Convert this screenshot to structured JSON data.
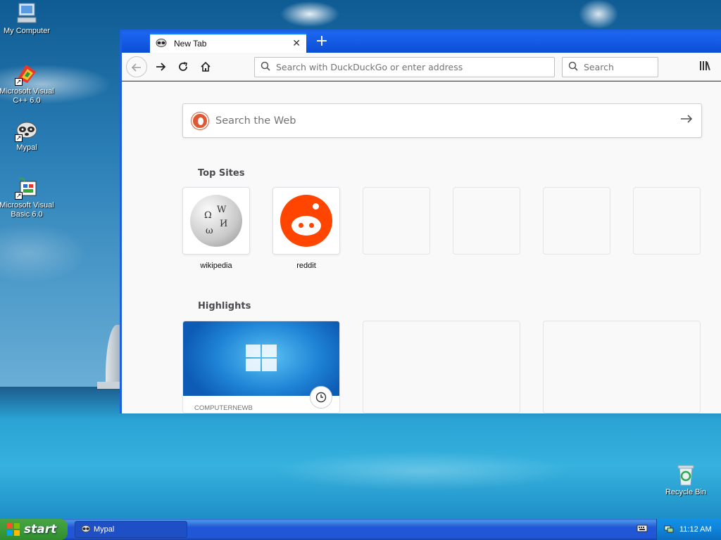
{
  "desktop": {
    "icons": [
      {
        "label": "My Computer"
      },
      {
        "label": "Microsoft Visual C++ 6.0"
      },
      {
        "label": "Mypal"
      },
      {
        "label": "Microsoft Visual Basic 6.0"
      },
      {
        "label": "Recycle Bin"
      }
    ]
  },
  "browser": {
    "tab": {
      "title": "New Tab",
      "close": "✕"
    },
    "new_tab": "+",
    "urlbar": {
      "placeholder": "Search with DuckDuckGo or enter address"
    },
    "searchbar": {
      "placeholder": "Search"
    },
    "websearch": {
      "placeholder": "Search the Web"
    },
    "top_sites_title": "Top Sites",
    "top_sites": [
      {
        "label": "wikipedia"
      },
      {
        "label": "reddit"
      }
    ],
    "highlights_title": "Highlights",
    "highlights": [
      {
        "source": "COMPUTERNEWB"
      }
    ]
  },
  "taskbar": {
    "start_label": "start",
    "task_item": "Mypal",
    "clock": "11:12 AM"
  },
  "colors": {
    "accent": "#0a84ff",
    "reddit": "#ff4500",
    "duckduckgo": "#de5833",
    "xp_blue": "#2157d7",
    "start_green": "#3c9a3a"
  }
}
